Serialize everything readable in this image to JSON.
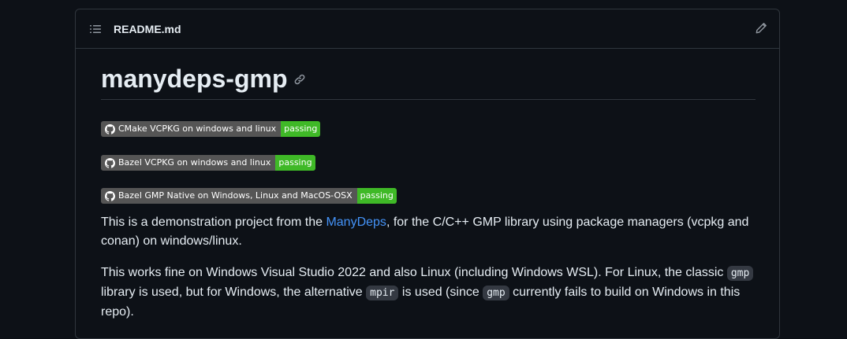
{
  "header": {
    "filename": "README.md",
    "toc_icon": "list-unordered-icon",
    "edit_icon": "pencil-icon"
  },
  "readme": {
    "title": "manydeps-gmp",
    "anchor_icon": "link-icon",
    "badges": [
      {
        "label": "CMake VCPKG on windows and linux",
        "status": "passing",
        "icon": "github-icon"
      },
      {
        "label": "Bazel VCPKG on windows and linux",
        "status": "passing",
        "icon": "github-icon"
      },
      {
        "label": "Bazel GMP Native on Windows, Linux and MacOS-OSX",
        "status": "passing",
        "icon": "github-icon"
      }
    ],
    "para1": {
      "before": "This is a demonstration project from the ",
      "link": "ManyDeps",
      "after": ", for the C/C++ GMP library using package managers (vcpkg and conan) on windows/linux."
    },
    "para2": {
      "t1": "This works fine on Windows Visual Studio 2022 and also Linux (including Windows WSL). For Linux, the classic ",
      "code1": "gmp",
      "t2": " library is used, but for Windows, the alternative ",
      "code2": "mpir",
      "t3": " is used (since ",
      "code3": "gmp",
      "t4": " currently fails to build on Windows in this repo)."
    }
  },
  "colors": {
    "background": "#0d1117",
    "border": "#30363d",
    "text": "#e6edf3",
    "link": "#4493f8",
    "badge_left": "#555555",
    "badge_passing": "#3fb927",
    "code_bg": "#343942"
  }
}
